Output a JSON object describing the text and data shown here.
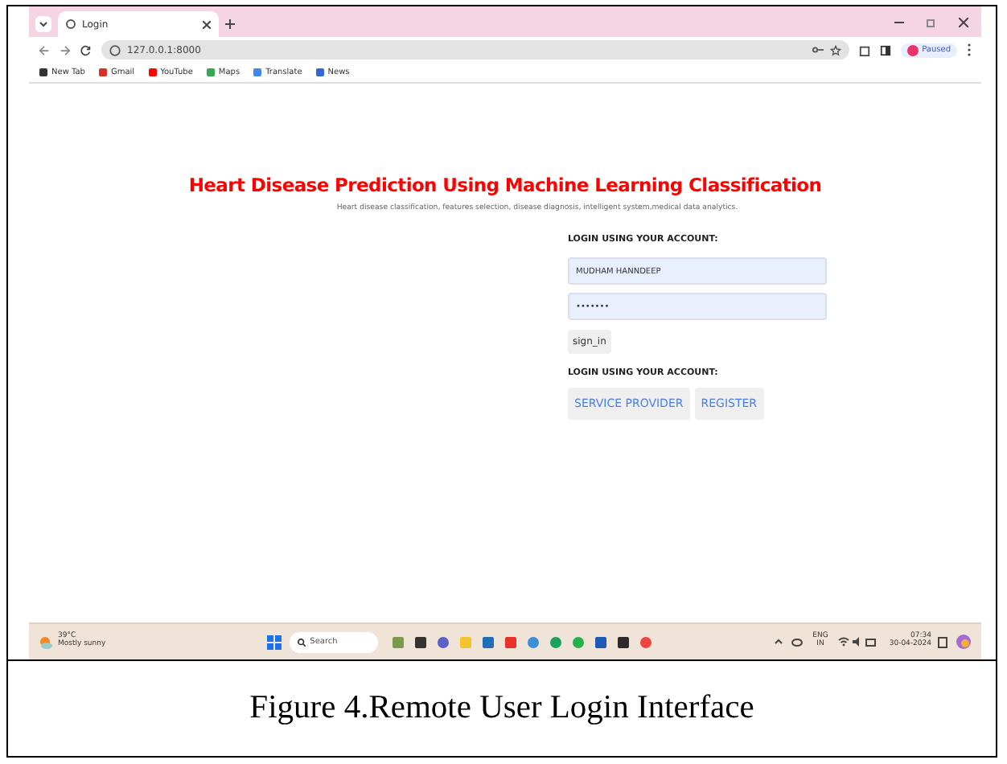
{
  "browser": {
    "tabs": [
      {
        "label": "Login",
        "selected": true
      }
    ],
    "url": "127.0.0.1:8000",
    "profile": "Paused",
    "bookmarks": [
      "New Tab",
      "Gmail",
      "YouTube",
      "Maps",
      "Translate",
      "News"
    ]
  },
  "page": {
    "title": "Heart Disease Prediction Using Machine Learning Classification",
    "subtitle": "Heart disease classification, features selection, disease diagnosis, intelligent system,medical data analytics.",
    "login_heading": "LOGIN USING YOUR ACCOUNT:",
    "username": "MUDHAM HANNDEEP",
    "password": "•••••••",
    "sign_in": "sign_in",
    "alt_heading": "LOGIN USING YOUR ACCOUNT:",
    "links": [
      "SERVICE PROVIDER",
      "REGISTER"
    ]
  },
  "taskbar": {
    "temperature": "39°C",
    "weather": "Mostly sunny",
    "search": "Search",
    "language": "ENG",
    "region": "IN",
    "time": "07:34",
    "date": "30-04-2024"
  },
  "caption": "Figure 4.Remote User Login Interface"
}
